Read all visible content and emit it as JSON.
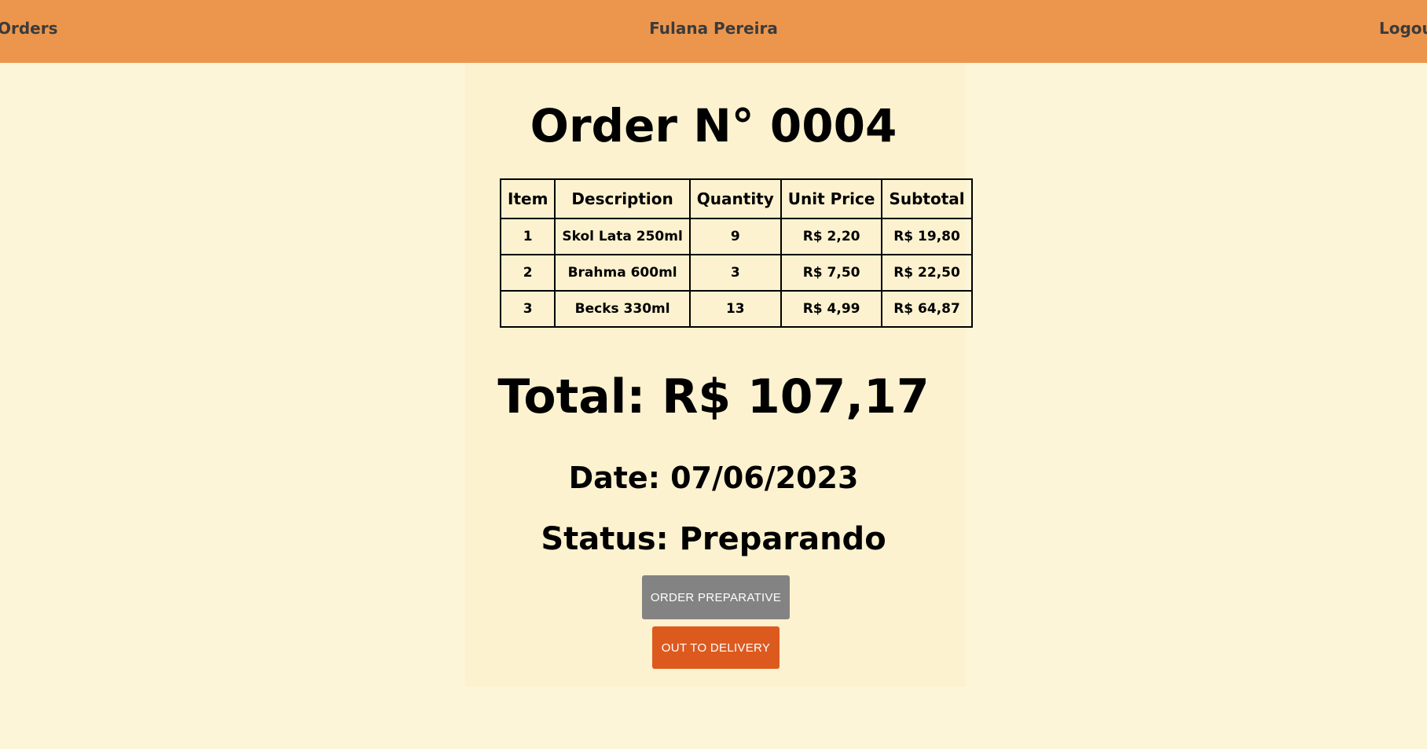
{
  "navbar": {
    "orders_label": "Orders",
    "user_name": "Fulana Pereira",
    "logout_label": "Logout"
  },
  "order": {
    "title": "Order N° 0004",
    "table": {
      "headers": [
        "Item",
        "Description",
        "Quantity",
        "Unit Price",
        "Subtotal"
      ],
      "rows": [
        [
          "1",
          "Skol Lata 250ml",
          "9",
          "R$ 2,20",
          "R$ 19,80"
        ],
        [
          "2",
          "Brahma 600ml",
          "3",
          "R$ 7,50",
          "R$ 22,50"
        ],
        [
          "3",
          "Becks 330ml",
          "13",
          "R$ 4,99",
          "R$ 64,87"
        ]
      ]
    },
    "total": "Total: R$ 107,17",
    "date": "Date: 07/06/2023",
    "status": "Status: Preparando"
  },
  "actions": {
    "preparative_label": "ORDER PREPARATIVE",
    "delivery_label": "OUT TO DELIVERY"
  },
  "colors": {
    "navbar": "#ec964d",
    "page_background": "#fdf5d7",
    "card_background": "#fcf2cf",
    "preparative_button": "#838383",
    "delivery_button": "#dd5a1f"
  }
}
